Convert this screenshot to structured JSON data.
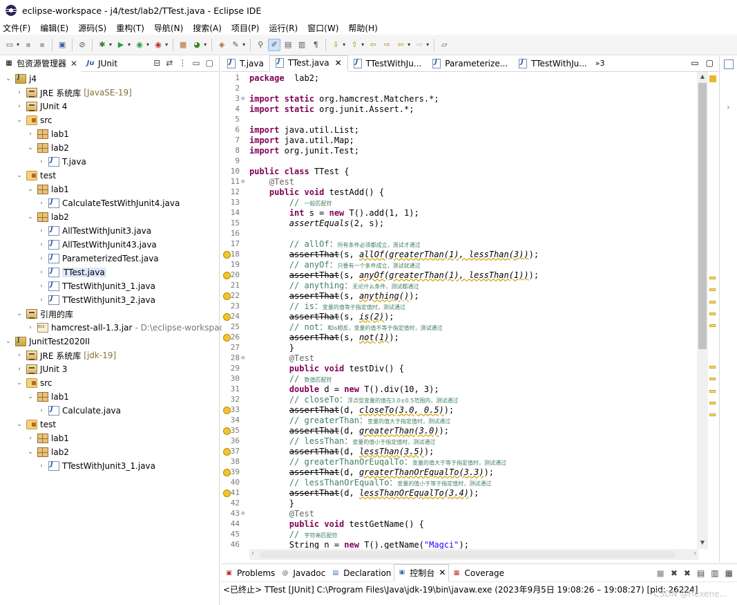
{
  "window": {
    "title": "eclipse-workspace - j4/test/lab2/TTest.java - Eclipse IDE"
  },
  "menu": [
    "文件(F)",
    "编辑(E)",
    "源码(S)",
    "重构(T)",
    "导航(N)",
    "搜索(A)",
    "项目(P)",
    "运行(R)",
    "窗口(W)",
    "帮助(H)"
  ],
  "left_panel": {
    "tabs": [
      {
        "label": "包资源管理器",
        "close": "✕"
      },
      {
        "label": "JUnit"
      }
    ],
    "tree": [
      {
        "label": "j4",
        "icon": "project",
        "chev": "⌄",
        "depth": 0
      },
      {
        "label": "JRE 系统库",
        "deco": "[JavaSE-19]",
        "icon": "lib",
        "chev": "›",
        "depth": 1
      },
      {
        "label": "JUnit 4",
        "icon": "lib",
        "chev": "›",
        "depth": 1
      },
      {
        "label": "src",
        "icon": "folder",
        "chev": "⌄",
        "depth": 1
      },
      {
        "label": "lab1",
        "icon": "package",
        "chev": "›",
        "depth": 2
      },
      {
        "label": "lab2",
        "icon": "package",
        "chev": "⌄",
        "depth": 2
      },
      {
        "label": "T.java",
        "icon": "java",
        "chev": "›",
        "depth": 3
      },
      {
        "label": "test",
        "icon": "folder",
        "chev": "⌄",
        "depth": 1
      },
      {
        "label": "lab1",
        "icon": "package",
        "chev": "⌄",
        "depth": 2
      },
      {
        "label": "CalculateTestWithJunit4.java",
        "icon": "java",
        "chev": "›",
        "depth": 3
      },
      {
        "label": "lab2",
        "icon": "package",
        "chev": "⌄",
        "depth": 2
      },
      {
        "label": "AllTestWithJunit3.java",
        "icon": "java",
        "chev": "›",
        "depth": 3
      },
      {
        "label": "AllTestWithJunit43.java",
        "icon": "java",
        "chev": "›",
        "depth": 3
      },
      {
        "label": "ParameterizedTest.java",
        "icon": "java",
        "chev": "›",
        "depth": 3
      },
      {
        "label": "TTest.java",
        "icon": "java",
        "chev": "›",
        "depth": 3,
        "selected": true
      },
      {
        "label": "TTestWithJunit3_1.java",
        "icon": "java",
        "chev": "›",
        "depth": 3
      },
      {
        "label": "TTestWithJunit3_2.java",
        "icon": "java",
        "chev": "›",
        "depth": 3
      },
      {
        "label": "引用的库",
        "icon": "lib",
        "chev": "⌄",
        "depth": 1
      },
      {
        "label": "hamcrest-all-1.3.jar",
        "deco": " - D:\\eclipse-workspace",
        "icon": "jar",
        "chev": "›",
        "depth": 2
      },
      {
        "label": "JunitTest2020II",
        "icon": "project",
        "chev": "⌄",
        "depth": 0
      },
      {
        "label": "JRE 系统库",
        "deco": "[jdk-19]",
        "icon": "lib",
        "chev": "›",
        "depth": 1
      },
      {
        "label": "JUnit 3",
        "icon": "lib",
        "chev": "›",
        "depth": 1
      },
      {
        "label": "src",
        "icon": "folder",
        "chev": "⌄",
        "depth": 1
      },
      {
        "label": "lab1",
        "icon": "package",
        "chev": "⌄",
        "depth": 2
      },
      {
        "label": "Calculate.java",
        "icon": "java",
        "chev": "›",
        "depth": 3
      },
      {
        "label": "test",
        "icon": "folder",
        "chev": "⌄",
        "depth": 1
      },
      {
        "label": "lab1",
        "icon": "package",
        "chev": "›",
        "depth": 2
      },
      {
        "label": "lab2",
        "icon": "package",
        "chev": "⌄",
        "depth": 2
      },
      {
        "label": "TTestWithJunit3_1.java",
        "icon": "java",
        "chev": "›",
        "depth": 3
      }
    ]
  },
  "editor": {
    "tabs": [
      {
        "label": "T.java"
      },
      {
        "label": "TTest.java",
        "active": true,
        "close": "✕"
      },
      {
        "label": "TTestWithJu..."
      },
      {
        "label": "Parameterize..."
      },
      {
        "label": "TTestWithJu..."
      }
    ],
    "overflow": "»3",
    "lines": [
      {
        "n": "1",
        "parts": [
          [
            "kw",
            "package"
          ],
          [
            "",
            "  lab2;"
          ]
        ]
      },
      {
        "n": "2",
        "parts": []
      },
      {
        "n": "3",
        "fold": "⊖",
        "parts": [
          [
            "kw",
            "import"
          ],
          [
            "",
            ""
          ],
          [
            "kw",
            " static"
          ],
          [
            "",
            " org.hamcrest.Matchers.*;"
          ]
        ]
      },
      {
        "n": "4",
        "parts": [
          [
            "kw",
            "import"
          ],
          [
            "kw",
            " static"
          ],
          [
            "",
            " org.junit.Assert.*;"
          ]
        ]
      },
      {
        "n": "5",
        "parts": []
      },
      {
        "n": "6",
        "parts": [
          [
            "kw",
            "import"
          ],
          [
            "",
            " java.util.List;"
          ]
        ]
      },
      {
        "n": "7",
        "parts": [
          [
            "kw",
            "import"
          ],
          [
            "",
            " java.util.Map;"
          ]
        ]
      },
      {
        "n": "8",
        "parts": [
          [
            "kw",
            "import"
          ],
          [
            "",
            " org.junit.Test;"
          ]
        ]
      },
      {
        "n": "9",
        "parts": []
      },
      {
        "n": "10",
        "parts": [
          [
            "kw",
            "public"
          ],
          [
            "kw",
            " class"
          ],
          [
            "",
            " TTest {"
          ]
        ]
      },
      {
        "n": "11",
        "fold": "⊖",
        "parts": [
          [
            "",
            "    "
          ],
          [
            "ann",
            "@Test"
          ]
        ]
      },
      {
        "n": "12",
        "parts": [
          [
            "",
            "    "
          ],
          [
            "kw",
            "public"
          ],
          [
            "kw",
            " void"
          ],
          [
            "",
            " testAdd() {"
          ]
        ]
      },
      {
        "n": "13",
        "parts": [
          [
            "",
            "        "
          ],
          [
            "cm",
            "// "
          ],
          [
            "cms",
            "一般匹配符"
          ]
        ]
      },
      {
        "n": "14",
        "parts": [
          [
            "",
            "        "
          ],
          [
            "kw",
            "int"
          ],
          [
            "",
            " s = "
          ],
          [
            "kw",
            "new"
          ],
          [
            "",
            " T().add(1, 1);"
          ]
        ]
      },
      {
        "n": "15",
        "parts": [
          [
            "",
            "        "
          ],
          [
            "it",
            "assertEquals"
          ],
          [
            "",
            "(2, s);"
          ]
        ]
      },
      {
        "n": "16",
        "parts": []
      },
      {
        "n": "17",
        "parts": [
          [
            "",
            "        "
          ],
          [
            "cm",
            "// allOf："
          ],
          [
            "cms",
            "所有条件必须都成立，测试才通过"
          ]
        ]
      },
      {
        "n": "18",
        "warn": true,
        "parts": [
          [
            "",
            "        "
          ],
          [
            "strike",
            "assertThat"
          ],
          [
            "",
            "(s, "
          ],
          [
            "itw",
            "allOf(greaterThan(1), lessThan(3))"
          ],
          [
            "",
            ");"
          ]
        ]
      },
      {
        "n": "19",
        "parts": [
          [
            "",
            "        "
          ],
          [
            "cm",
            "// anyOf："
          ],
          [
            "cms",
            "只要有一个条件成立，测试就通过"
          ]
        ]
      },
      {
        "n": "20",
        "warn": true,
        "parts": [
          [
            "",
            "        "
          ],
          [
            "strike",
            "assertThat"
          ],
          [
            "",
            "(s, "
          ],
          [
            "itw",
            "anyOf(greaterThan(1), lessThan(1))"
          ],
          [
            "",
            ");"
          ]
        ]
      },
      {
        "n": "21",
        "parts": [
          [
            "",
            "        "
          ],
          [
            "cm",
            "// anything："
          ],
          [
            "cms",
            "无论什么条件，测试都通过"
          ]
        ]
      },
      {
        "n": "22",
        "warn": true,
        "parts": [
          [
            "",
            "        "
          ],
          [
            "strike",
            "assertThat"
          ],
          [
            "",
            "(s, "
          ],
          [
            "itw",
            "anything()"
          ],
          [
            "",
            ");"
          ]
        ]
      },
      {
        "n": "23",
        "parts": [
          [
            "",
            "        "
          ],
          [
            "cm",
            "// is："
          ],
          [
            "cms",
            "变量的值等于指定值时，测试通过"
          ]
        ]
      },
      {
        "n": "24",
        "warn": true,
        "parts": [
          [
            "",
            "        "
          ],
          [
            "strike",
            "assertThat"
          ],
          [
            "",
            "(s, "
          ],
          [
            "itw",
            "is(2)"
          ],
          [
            "",
            ");"
          ]
        ]
      },
      {
        "n": "25",
        "parts": [
          [
            "",
            "        "
          ],
          [
            "cm",
            "// not："
          ],
          [
            "cms",
            "和is相反，变量的值不等于指定值时，测试通过"
          ]
        ]
      },
      {
        "n": "26",
        "warn": true,
        "parts": [
          [
            "",
            "        "
          ],
          [
            "strike",
            "assertThat"
          ],
          [
            "",
            "(s, "
          ],
          [
            "itw",
            "not(1)"
          ],
          [
            "",
            ");"
          ]
        ]
      },
      {
        "n": "27",
        "parts": [
          [
            "",
            "        }"
          ]
        ]
      },
      {
        "n": "28",
        "fold": "⊖",
        "parts": [
          [
            "",
            "        "
          ],
          [
            "ann",
            "@Test"
          ]
        ]
      },
      {
        "n": "29",
        "parts": [
          [
            "",
            "        "
          ],
          [
            "kw",
            "public"
          ],
          [
            "kw",
            " void"
          ],
          [
            "",
            " testDiv() {"
          ]
        ]
      },
      {
        "n": "30",
        "parts": [
          [
            "",
            "        "
          ],
          [
            "cm",
            "// "
          ],
          [
            "cms",
            "数值匹配符"
          ]
        ]
      },
      {
        "n": "31",
        "parts": [
          [
            "",
            "        "
          ],
          [
            "kw",
            "double"
          ],
          [
            "",
            " d = "
          ],
          [
            "kw",
            "new"
          ],
          [
            "",
            " T().div(10, 3);"
          ]
        ]
      },
      {
        "n": "32",
        "parts": [
          [
            "",
            "        "
          ],
          [
            "cm",
            "// closeTo："
          ],
          [
            "cms",
            "浮点型变量的值在3.0±0.5范围内，测试通过"
          ]
        ]
      },
      {
        "n": "33",
        "warn": true,
        "parts": [
          [
            "",
            "        "
          ],
          [
            "strike",
            "assertThat"
          ],
          [
            "",
            "(d, "
          ],
          [
            "itw",
            "closeTo(3.0, 0.5)"
          ],
          [
            "",
            ");"
          ]
        ]
      },
      {
        "n": "34",
        "parts": [
          [
            "",
            "        "
          ],
          [
            "cm",
            "// greaterThan："
          ],
          [
            "cms",
            "变量的值大于指定值时，测试通过"
          ]
        ]
      },
      {
        "n": "35",
        "warn": true,
        "parts": [
          [
            "",
            "        "
          ],
          [
            "strike",
            "assertThat"
          ],
          [
            "",
            "(d, "
          ],
          [
            "itw",
            "greaterThan(3.0)"
          ],
          [
            "",
            ");"
          ]
        ]
      },
      {
        "n": "36",
        "parts": [
          [
            "",
            "        "
          ],
          [
            "cm",
            "// lessThan："
          ],
          [
            "cms",
            "变量的值小于指定值时，测试通过"
          ]
        ]
      },
      {
        "n": "37",
        "warn": true,
        "parts": [
          [
            "",
            "        "
          ],
          [
            "strike",
            "assertThat"
          ],
          [
            "",
            "(d, "
          ],
          [
            "itw",
            "lessThan(3.5)"
          ],
          [
            "",
            ");"
          ]
        ]
      },
      {
        "n": "38",
        "parts": [
          [
            "",
            "        "
          ],
          [
            "cm",
            "// greaterThanOrEuqalTo："
          ],
          [
            "cms",
            "变量的值大于等于指定值时，测试通过"
          ]
        ]
      },
      {
        "n": "39",
        "warn": true,
        "parts": [
          [
            "",
            "        "
          ],
          [
            "strike",
            "assertThat"
          ],
          [
            "",
            "(d, "
          ],
          [
            "itw",
            "greaterThanOrEqualTo(3.3)"
          ],
          [
            "",
            ");"
          ]
        ]
      },
      {
        "n": "40",
        "parts": [
          [
            "",
            "        "
          ],
          [
            "cm",
            "// lessThanOrEqualTo："
          ],
          [
            "cms",
            "变量的值小于等于指定值时，测试通过"
          ]
        ]
      },
      {
        "n": "41",
        "warn": true,
        "parts": [
          [
            "",
            "        "
          ],
          [
            "strike",
            "assertThat"
          ],
          [
            "",
            "(d, "
          ],
          [
            "itw",
            "lessThanOrEqualTo(3.4)"
          ],
          [
            "",
            ");"
          ]
        ]
      },
      {
        "n": "42",
        "parts": [
          [
            "",
            "        }"
          ]
        ]
      },
      {
        "n": "43",
        "fold": "⊖",
        "parts": [
          [
            "",
            "        "
          ],
          [
            "ann",
            "@Test"
          ]
        ]
      },
      {
        "n": "44",
        "parts": [
          [
            "",
            "        "
          ],
          [
            "kw",
            "public"
          ],
          [
            "kw",
            " void"
          ],
          [
            "",
            " testGetName() {"
          ]
        ]
      },
      {
        "n": "45",
        "parts": [
          [
            "",
            "        "
          ],
          [
            "cm",
            "// "
          ],
          [
            "cms",
            "字符串匹配符"
          ]
        ]
      },
      {
        "n": "46",
        "parts": [
          [
            "",
            "        String n = "
          ],
          [
            "kw",
            "new"
          ],
          [
            "",
            " T().getName("
          ],
          [
            "str",
            "\"Magci\""
          ],
          [
            "",
            ");"
          ]
        ]
      }
    ]
  },
  "console": {
    "tabs": [
      {
        "label": "Problems",
        "icon": "problems-icon"
      },
      {
        "label": "Javadoc",
        "icon": "at-icon"
      },
      {
        "label": "Declaration",
        "icon": "declaration-icon"
      },
      {
        "label": "控制台",
        "icon": "console-icon",
        "active": true,
        "close": "✕"
      },
      {
        "label": "Coverage",
        "icon": "coverage-icon"
      }
    ],
    "status": "<已终止> TTest [JUnit] C:\\Program Files\\Java\\jdk-19\\bin\\javaw.exe  (2023年9月5日 19:08:26 – 19:08:27) [pid: 26224]",
    "watermark": "CSDN @Hexene..."
  }
}
